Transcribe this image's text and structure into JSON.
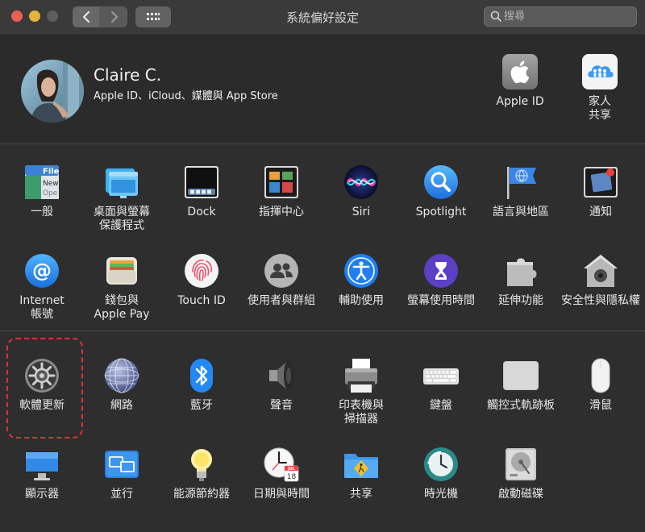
{
  "window": {
    "title": "系統偏好設定"
  },
  "search": {
    "placeholder": "搜尋"
  },
  "account": {
    "name": "Claire C.",
    "subtitle": "Apple ID、iCloud、媒體與 App Store",
    "items": [
      {
        "label": "Apple ID",
        "icon": "apple-logo-icon"
      },
      {
        "label": "家人\n共享",
        "icon": "family-sharing-icon"
      }
    ]
  },
  "row1": [
    {
      "label": "一般",
      "icon": "general-icon"
    },
    {
      "label": "桌面與螢幕\n保護程式",
      "icon": "desktop-screensaver-icon"
    },
    {
      "label": "Dock",
      "icon": "dock-icon"
    },
    {
      "label": "指揮中心",
      "icon": "mission-control-icon"
    },
    {
      "label": "Siri",
      "icon": "siri-icon"
    },
    {
      "label": "Spotlight",
      "icon": "spotlight-icon"
    },
    {
      "label": "語言與地區",
      "icon": "language-region-icon"
    },
    {
      "label": "通知",
      "icon": "notifications-icon"
    }
  ],
  "row2": [
    {
      "label": "Internet\n帳號",
      "icon": "internet-accounts-icon"
    },
    {
      "label": "錢包與\nApple Pay",
      "icon": "wallet-icon"
    },
    {
      "label": "Touch ID",
      "icon": "fingerprint-icon"
    },
    {
      "label": "使用者與群組",
      "icon": "users-groups-icon"
    },
    {
      "label": "輔助使用",
      "icon": "accessibility-icon"
    },
    {
      "label": "螢幕使用時間",
      "icon": "screen-time-icon"
    },
    {
      "label": "延伸功能",
      "icon": "extensions-icon"
    },
    {
      "label": "安全性與隱私權",
      "icon": "security-privacy-icon"
    }
  ],
  "row3": [
    {
      "label": "軟體更新",
      "icon": "software-update-icon"
    },
    {
      "label": "網路",
      "icon": "network-icon"
    },
    {
      "label": "藍牙",
      "icon": "bluetooth-icon"
    },
    {
      "label": "聲音",
      "icon": "sound-icon"
    },
    {
      "label": "印表機與\n掃描器",
      "icon": "printer-icon"
    },
    {
      "label": "鍵盤",
      "icon": "keyboard-icon"
    },
    {
      "label": "觸控式軌跡板",
      "icon": "trackpad-icon"
    },
    {
      "label": "滑鼠",
      "icon": "mouse-icon"
    }
  ],
  "row4": [
    {
      "label": "顯示器",
      "icon": "displays-icon"
    },
    {
      "label": "並行",
      "icon": "sidecar-icon"
    },
    {
      "label": "能源節約器",
      "icon": "energy-saver-icon"
    },
    {
      "label": "日期與時間",
      "icon": "date-time-icon",
      "calendar_month": "JUL",
      "calendar_day": "18"
    },
    {
      "label": "共享",
      "icon": "sharing-icon"
    },
    {
      "label": "時光機",
      "icon": "time-machine-icon"
    },
    {
      "label": "啟動磁碟",
      "icon": "startup-disk-icon"
    }
  ],
  "icons_extra": {
    "general_file": "File",
    "general_new": "New",
    "general_ope": "Ope"
  },
  "colors": {
    "highlight": "#e0302e",
    "accent": "#1a84f5"
  }
}
